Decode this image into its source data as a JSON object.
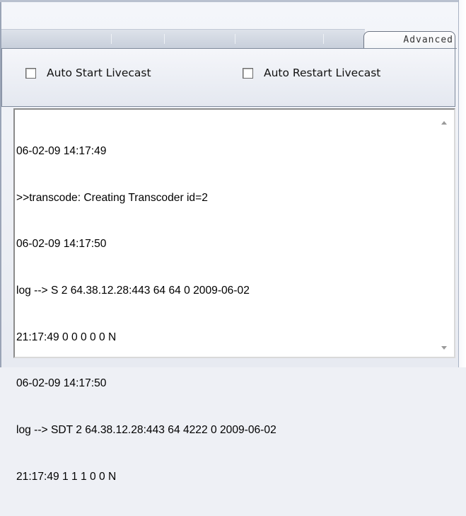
{
  "tabs": {
    "active_label": "Advanced"
  },
  "options": {
    "auto_start_label": "Auto Start Livecast",
    "auto_start_checked": false,
    "auto_restart_label": "Auto Restart Livecast",
    "auto_restart_checked": false
  },
  "log": {
    "lines": [
      "06-02-09 14:17:49",
      ">>transcode: Creating Transcoder id=2",
      "06-02-09 14:17:50",
      "log --> S 2 64.38.12.28:443 64 64 0 2009-06-02",
      "21:17:49 0 0 0 0 0 N",
      "06-02-09 14:17:50",
      "log --> SDT 2 64.38.12.28:443 64 4222 0 2009-06-02",
      "21:17:49 1 1 1 0 0 N"
    ]
  }
}
